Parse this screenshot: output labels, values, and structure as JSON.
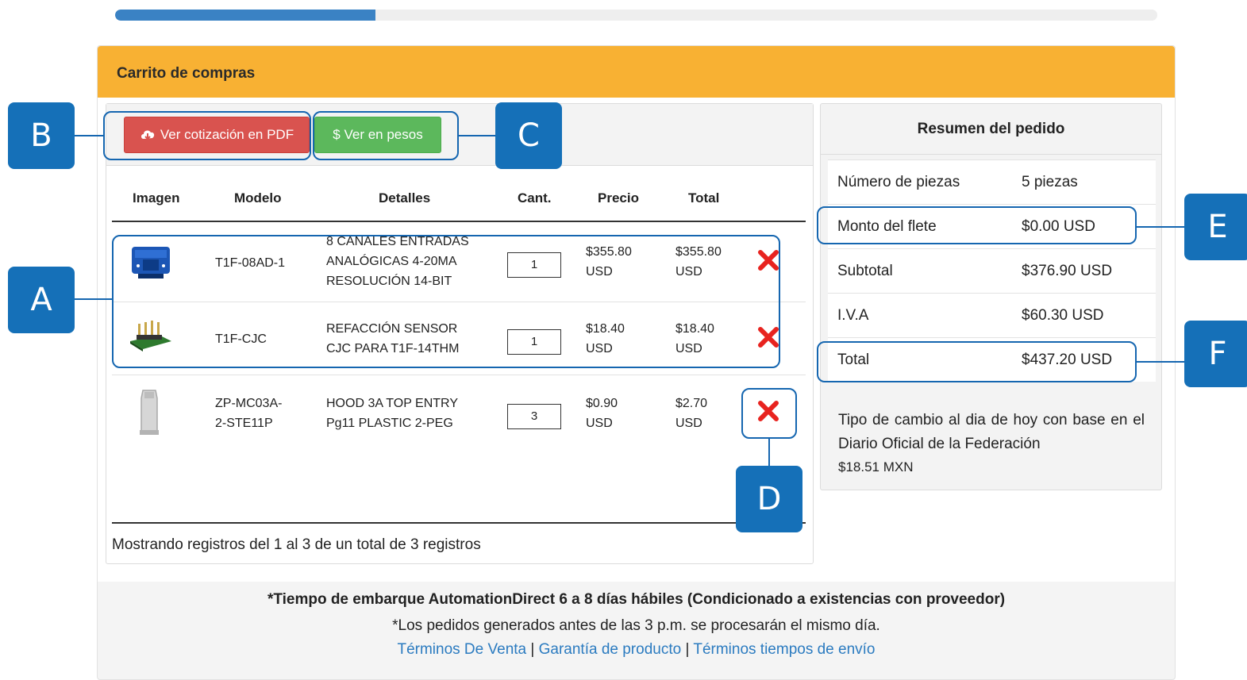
{
  "progress": {
    "fraction": 0.25
  },
  "cart": {
    "title": "Carrito de compras",
    "pdf_button": "Ver cotización en PDF",
    "pesos_button": "$ Ver en pesos",
    "columns": [
      "Imagen",
      "Modelo",
      "Detalles",
      "Cant.",
      "Precio",
      "Total"
    ],
    "items": [
      {
        "model": [
          "T1F-08AD-1"
        ],
        "details": [
          "8 CANALES ENTRADAS",
          "ANALÓGICAS 4-20MA",
          "RESOLUCIÓN 14-BIT"
        ],
        "qty": "1",
        "price": [
          "$355.80",
          "USD"
        ],
        "total": [
          "$355.80",
          "USD"
        ],
        "image_icon": "analog-module-icon"
      },
      {
        "model": [
          "T1F-CJC"
        ],
        "details": [
          "REFACCIÓN SENSOR",
          "CJC PARA T1F-14THM"
        ],
        "qty": "1",
        "price": [
          "$18.40",
          "USD"
        ],
        "total": [
          "$18.40",
          "USD"
        ],
        "image_icon": "sensor-board-icon"
      },
      {
        "model": [
          "ZP-MC03A-",
          "2-STE11P"
        ],
        "details": [
          "HOOD 3A TOP ENTRY",
          "Pg11 PLASTIC 2-PEG"
        ],
        "qty": "3",
        "price": [
          "$0.90",
          "USD"
        ],
        "total": [
          "$2.70",
          "USD"
        ],
        "image_icon": "connector-hood-icon"
      }
    ],
    "records_text": "Mostrando registros del 1 al 3 de un total de 3 registros"
  },
  "summary": {
    "title": "Resumen del pedido",
    "rows": [
      {
        "label": "Número de piezas",
        "value": "5 piezas"
      },
      {
        "label": "Monto del flete",
        "value": "$0.00 USD"
      },
      {
        "label": "Subtotal",
        "value": "$376.90 USD"
      },
      {
        "label": "I.V.A",
        "value": "$60.30 USD"
      },
      {
        "label": "Total",
        "value": "$437.20 USD"
      }
    ],
    "exchange_text": "Tipo de cambio al dia de hoy con base en el Diario Oficial de la Federación",
    "exchange_value": "$18.51 MXN"
  },
  "footer": {
    "shipping_note": "*Tiempo de embarque AutomationDirect 6 a 8 días hábiles (Condicionado a existencias con proveedor)",
    "order_note": "*Los pedidos generados antes de las 3 p.m. se procesarán el mismo día.",
    "links": [
      "Términos De Venta",
      "Garantía de producto",
      "Términos tiempos de envío"
    ],
    "separator": "|"
  },
  "annotations": [
    "A",
    "B",
    "C",
    "D",
    "E",
    "F"
  ],
  "colors": {
    "header": "#f8b133",
    "pdf_button": "#d9534f",
    "pesos_button": "#5cb85c",
    "annotation": "#1570b8",
    "link": "#2b7bc0",
    "delete": "#e8231f"
  }
}
